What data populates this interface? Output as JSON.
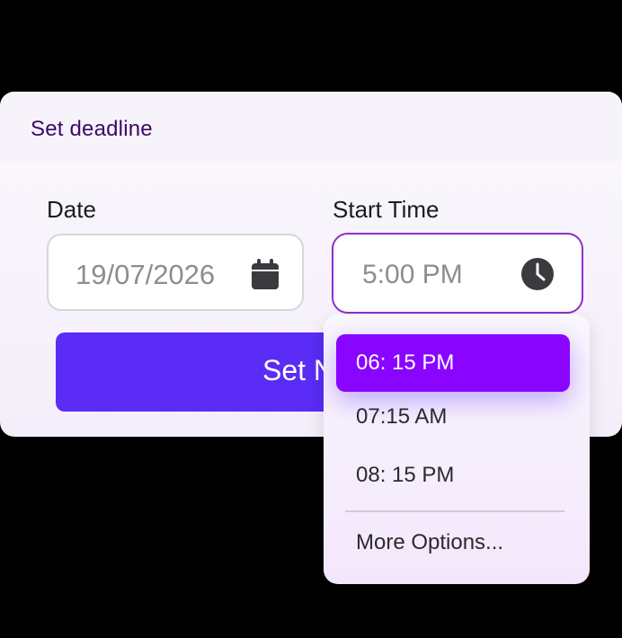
{
  "card": {
    "title": "Set deadline"
  },
  "date": {
    "label": "Date",
    "value": "19/07/2026",
    "icon": "calendar-icon"
  },
  "time": {
    "label": "Start Time",
    "value": "5:00 PM",
    "icon": "clock-icon"
  },
  "primary_button": {
    "label_visible": "Set N"
  },
  "dropdown": {
    "options": [
      {
        "label": "06: 15 PM",
        "selected": true
      },
      {
        "label": "07:15 AM",
        "selected": false
      },
      {
        "label": "08: 15 PM",
        "selected": false
      }
    ],
    "more_label": "More Options..."
  },
  "colors": {
    "accent": "#8a05ff",
    "button": "#5a2cf5",
    "title": "#3b0a66",
    "focus_border": "#8e2fc8"
  }
}
